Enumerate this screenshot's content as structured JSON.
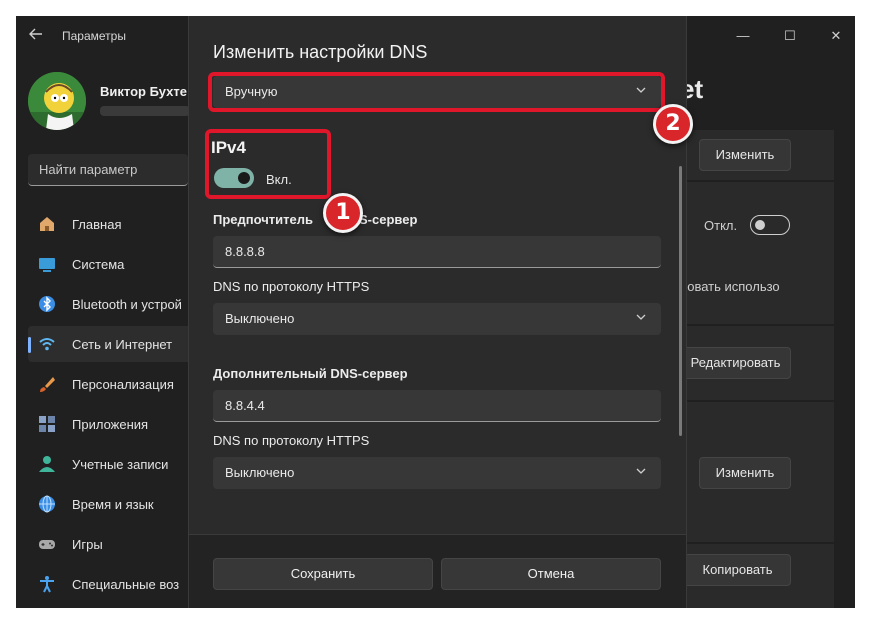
{
  "app": {
    "title": "Параметры"
  },
  "window_controls": {
    "minimize": "—",
    "maximize": "☐",
    "close": "✕"
  },
  "profile": {
    "name": "Виктор Бухте"
  },
  "search": {
    "placeholder": "Найти параметр"
  },
  "sidebar": {
    "items": [
      {
        "label": "Главная",
        "icon": "home-icon",
        "color": "#e0a86b"
      },
      {
        "label": "Система",
        "icon": "system-icon",
        "color": "#3a9bd9"
      },
      {
        "label": "Bluetooth и устрой",
        "icon": "bluetooth-icon",
        "color": "#3a8ee6"
      },
      {
        "label": "Сеть и Интернет",
        "icon": "wifi-icon",
        "color": "#5fb6f0",
        "active": true
      },
      {
        "label": "Персонализация",
        "icon": "brush-icon",
        "color": "#e89a4a"
      },
      {
        "label": "Приложения",
        "icon": "apps-icon",
        "color": "#8aa2c8"
      },
      {
        "label": "Учетные записи",
        "icon": "account-icon",
        "color": "#3fb59a"
      },
      {
        "label": "Время и язык",
        "icon": "globe-icon",
        "color": "#3a8ee6"
      },
      {
        "label": "Игры",
        "icon": "gamepad-icon",
        "color": "#a8a8a8"
      },
      {
        "label": "Специальные воз",
        "icon": "accessibility-icon",
        "color": "#4aa3f0"
      }
    ]
  },
  "background": {
    "heading_fragment": "et",
    "change_button_1": "Изменить",
    "toggle_label": "Откл.",
    "usage_text": "ровать использо",
    "edit_button": "Редактировать",
    "change_button_2": "Изменить",
    "copy_button": "Копировать"
  },
  "dialog": {
    "title": "Изменить настройки DNS",
    "mode_select": "Вручную",
    "ipv4_heading": "IPv4",
    "ipv4_toggle_label": "Вкл.",
    "preferred_label": "Предпочтитель",
    "preferred_label_tail": "S-сервер",
    "preferred_value": "8.8.8.8",
    "https_label_1": "DNS по протоколу HTTPS",
    "https_value_1": "Выключено",
    "alternate_label": "Дополнительный DNS-сервер",
    "alternate_value": "8.8.4.4",
    "https_label_2": "DNS по протоколу HTTPS",
    "https_value_2": "Выключено",
    "save_button": "Сохранить",
    "cancel_button": "Отмена"
  },
  "annotations": {
    "badge_1": "1",
    "badge_2": "2",
    "highlight_color": "#e0162b"
  }
}
